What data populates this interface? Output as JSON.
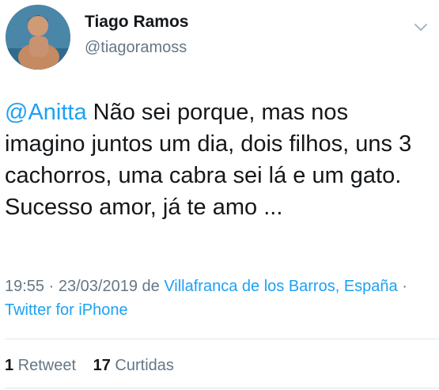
{
  "author": {
    "display_name": "Tiago Ramos",
    "handle": "@tiagoramoss"
  },
  "tweet": {
    "mention": "@Anitta",
    "body": " Não sei porque, mas nos imagino juntos um dia, dois filhos, uns 3 cachorros, uma cabra sei lá e um gato. Sucesso amor, já te amo ..."
  },
  "meta": {
    "time": "19:55",
    "separator1": " · ",
    "date": "23/03/2019",
    "from_label": " de ",
    "location": "Villafranca de los Barros, España",
    "separator2": " · ",
    "source": "Twitter for iPhone"
  },
  "stats": {
    "retweets_count": "1",
    "retweets_label": " Retweet",
    "likes_count": "17",
    "likes_label": " Curtidas"
  },
  "icons": {
    "menu": "chevron-down-icon"
  },
  "colors": {
    "link": "#1da1f2",
    "secondary_text": "#657786",
    "primary_text": "#14171a"
  }
}
